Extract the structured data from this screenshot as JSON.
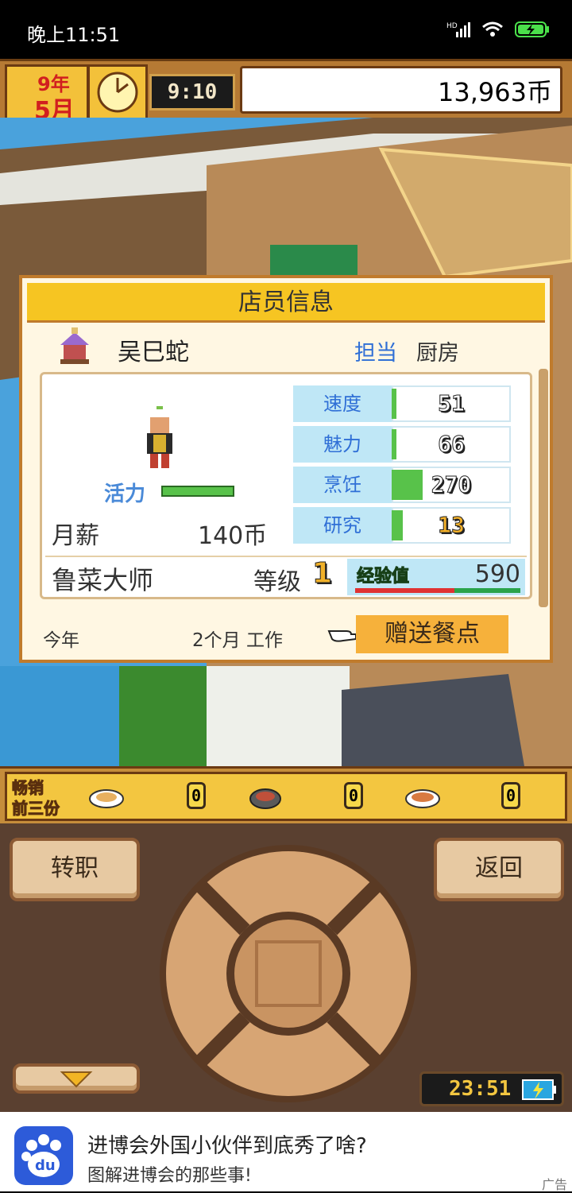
{
  "status_bar": {
    "time": "晚上11:51"
  },
  "top_bar": {
    "year": "9年",
    "month": "5月",
    "clock_time": "9:10",
    "money": "13,963币"
  },
  "dialog": {
    "title": "店员信息",
    "employee_name": "吴巳蛇",
    "assignment_label": "担当",
    "assignment_value": "厨房",
    "vitality_label": "活力",
    "salary_label": "月薪",
    "salary_value": "140币",
    "stats": [
      {
        "name": "速度",
        "value": "51",
        "level": 0.03
      },
      {
        "name": "魅力",
        "value": "66",
        "level": 0.04
      },
      {
        "name": "烹饪",
        "value": "270",
        "level": 0.26
      },
      {
        "name": "研究",
        "value": "13",
        "level": 0.09
      }
    ],
    "specialty": "鲁菜大师",
    "level_label": "等级",
    "level_value": "1",
    "exp_label": "经验值",
    "exp_value": "590",
    "exp_progress": 0.6,
    "this_year_label": "今年",
    "work_duration": "2个月 工作",
    "gift_button": "赠送餐点"
  },
  "bestsellers": {
    "label_line1": "畅销",
    "label_line2": "前三份",
    "counts": [
      "0",
      "0",
      "0"
    ]
  },
  "controls": {
    "transfer_button": "转职",
    "back_button": "返回",
    "game_clock": "23:51"
  },
  "ad": {
    "headline": "进博会外国小伙伴到底秀了啥?",
    "subline": "图解进博会的那些事!",
    "tag": "广告"
  }
}
